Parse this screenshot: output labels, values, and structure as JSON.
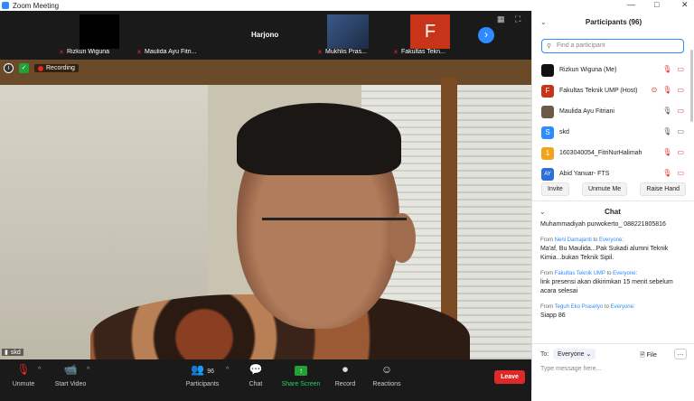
{
  "window": {
    "title": "Zoom Meeting",
    "minimize": "—",
    "maximize": "□",
    "close": "✕"
  },
  "strip": {
    "tiles": [
      {
        "name": "Rizkun Wiguna",
        "muted": true
      },
      {
        "name": "Maulida Ayu Fitri...",
        "muted": true
      },
      {
        "name": "Harjono",
        "muted": false
      },
      {
        "name": "Mukhlis Pras...",
        "muted": true
      },
      {
        "name": "Fakultas Tekn...",
        "muted": true
      }
    ],
    "next": "›"
  },
  "video": {
    "recording_label": "Recording",
    "speaker": "skd"
  },
  "toolbar": {
    "unmute": "Unmute",
    "start_video": "Start Video",
    "participants": "Participants",
    "participants_count": "96",
    "chat": "Chat",
    "share_screen": "Share Screen",
    "record": "Record",
    "reactions": "Reactions",
    "leave": "Leave"
  },
  "panel": {
    "participants_title": "Participants (96)",
    "search_placeholder": "Find a participant",
    "participants": [
      {
        "initial": "",
        "name": "Rizkun Wiguna (Me)",
        "color": "#111111"
      },
      {
        "initial": "F",
        "name": "Fakultas Teknik UMP (Host)",
        "color": "#c8341a"
      },
      {
        "initial": "",
        "name": "Maulida Ayu Fitriani",
        "color": "#6b5a48"
      },
      {
        "initial": "S",
        "name": "skd",
        "color": "#2d8cff"
      },
      {
        "initial": "1",
        "name": "1603040054_FitriNurHalimah",
        "color": "#f2a31c"
      },
      {
        "initial": "AY",
        "name": "Abid Yanuar- FTS",
        "color": "#2d6fd6"
      }
    ],
    "invite": "Invite",
    "unmute_me": "Unmute Me",
    "raise_hand": "Raise Hand",
    "chat_title": "Chat",
    "messages": [
      {
        "sender": "",
        "to": "",
        "text": "Muhammadiyah purwokerto_ 088221805816"
      },
      {
        "sender": "Neni Damajanti",
        "to": "Everyone",
        "text": "Ma'af, Bu Maulida...Pak Sukadi alumni Teknik Kimia...bukan Teknik Sipil."
      },
      {
        "sender": "Fakultas Teknik UMP",
        "to": "Everyone",
        "text": "link presensi akan dikirimkan 15 menit sebelum acara selesai"
      },
      {
        "sender": "Teguh Eko Prasetyo",
        "to": "Everyone",
        "text": "Siapp 86"
      }
    ],
    "to_label": "To:",
    "to_value": "Everyone",
    "file": "File",
    "more": "…",
    "type_placeholder": "Type message here..."
  },
  "colors": {
    "accent": "#2d8cff",
    "leave": "#e02828",
    "share": "#23a036"
  }
}
